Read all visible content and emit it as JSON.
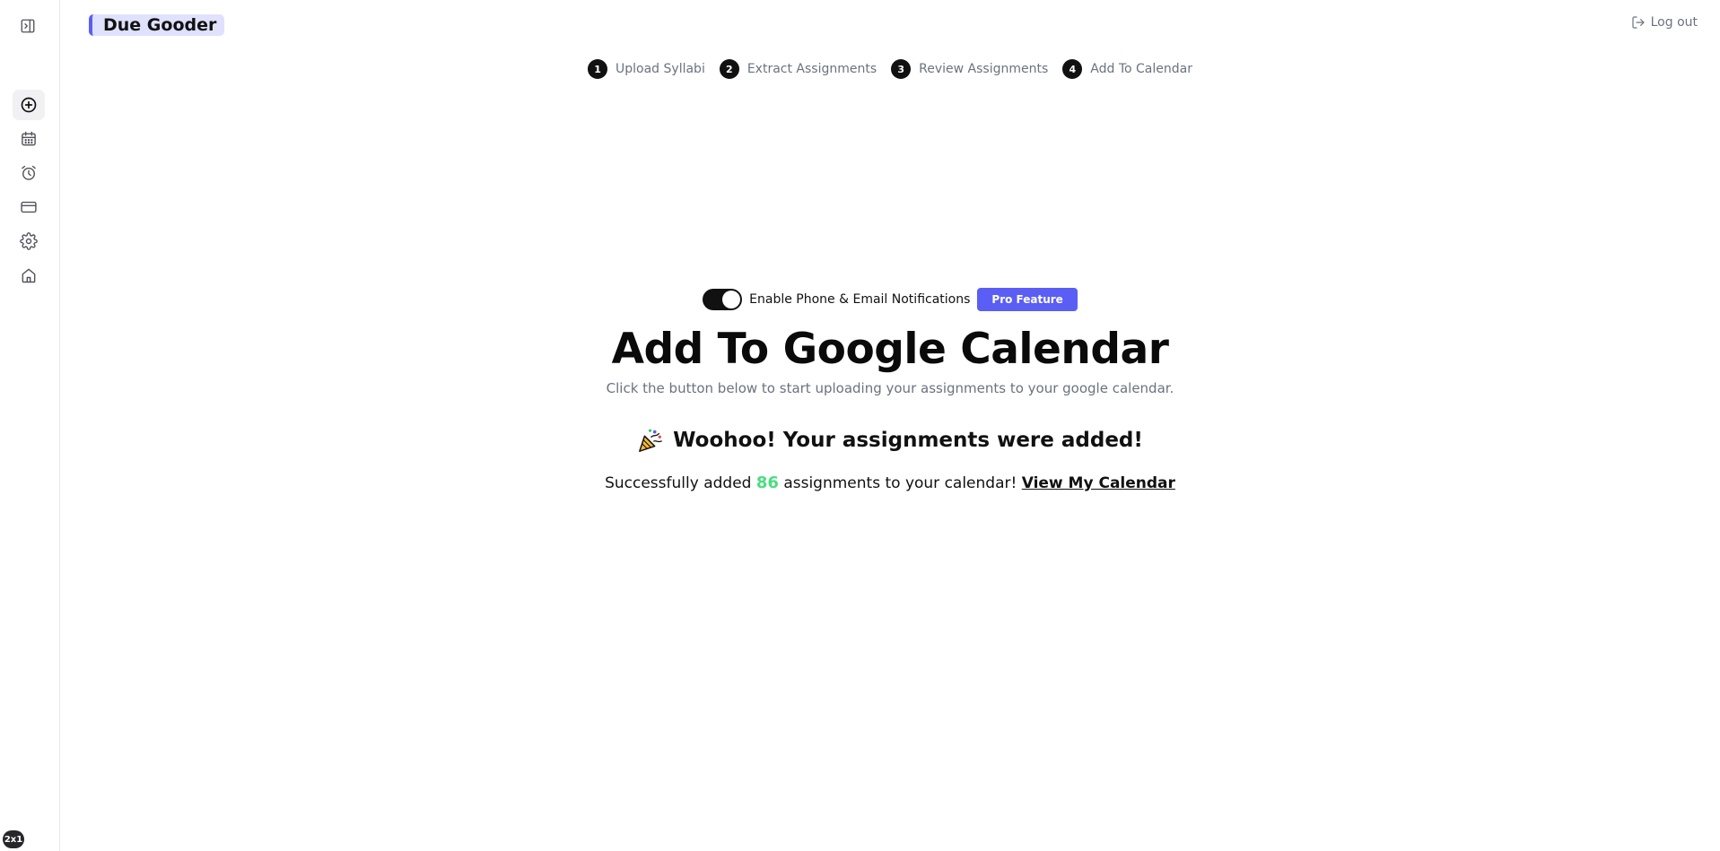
{
  "app": {
    "logo": "Due Gooder"
  },
  "header": {
    "logout_label": "Log out"
  },
  "sidebar": {
    "items": [
      {
        "icon": "plus-circle-icon",
        "active": true
      },
      {
        "icon": "calendar-icon",
        "active": false
      },
      {
        "icon": "alarm-clock-icon",
        "active": false
      },
      {
        "icon": "credit-card-icon",
        "active": false
      },
      {
        "icon": "gear-icon",
        "active": false
      },
      {
        "icon": "home-icon",
        "active": false
      }
    ],
    "badge": "2x1"
  },
  "steps": [
    {
      "number": "1",
      "label": "Upload Syllabi"
    },
    {
      "number": "2",
      "label": "Extract Assignments"
    },
    {
      "number": "3",
      "label": "Review Assignments"
    },
    {
      "number": "4",
      "label": "Add To Calendar"
    }
  ],
  "notifications": {
    "toggle_on": true,
    "label": "Enable Phone & Email Notifications",
    "pro_badge": "Pro Feature"
  },
  "main": {
    "title": "Add To Google Calendar",
    "subtitle": "Click the button below to start uploading your assignments to your google calendar.",
    "success_heading": "Woohoo! Your assignments were added!",
    "success_prefix": "Successfully added",
    "count": "86",
    "success_suffix": "assignments to your calendar!",
    "view_link": "View My Calendar"
  },
  "colors": {
    "accent": "#5b5ef4",
    "logo_bg": "#dfe1fd",
    "count": "#4ade80"
  }
}
